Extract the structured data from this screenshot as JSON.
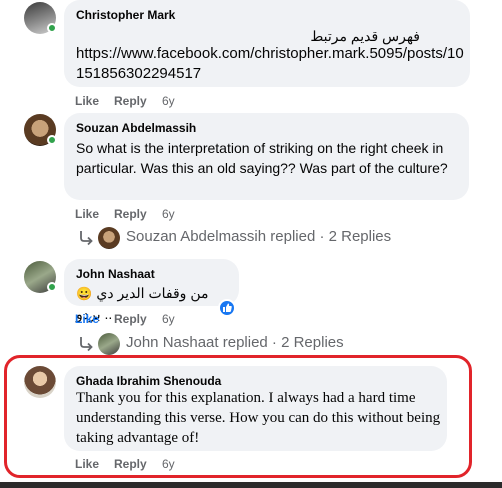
{
  "comments": [
    {
      "author": "Christopher Mark",
      "text_rtl": "فهرس قديم مرتبط",
      "text": "https://www.facebook.com/christopher.mark.5095/posts/10151856302294517",
      "actions": {
        "like": "Like",
        "reply": "Reply",
        "age": "6y"
      }
    },
    {
      "author": "Souzan Abdelmassih",
      "text": "So what is the interpretation of striking on the right cheek in particular. Was this an old saying?? Was part of the culture?",
      "actions": {
        "like": "Like",
        "reply": "Reply",
        "age": "6y"
      },
      "replies_summary": "Souzan Abdelmassih replied · 2 Replies"
    },
    {
      "author": "John Nashaat",
      "text_rtl": "من وقفات الدير دي بردو ..",
      "emoji": "😀",
      "actions": {
        "like": "Like",
        "reply": "Reply",
        "age": "6y"
      },
      "replies_summary": "John Nashaat replied · 2 Replies"
    },
    {
      "author": "Ghada Ibrahim Shenouda",
      "text": "Thank you for this explanation. I always had a hard time understanding this verse. How you can do this without being taking advantage of!",
      "actions": {
        "like": "Like",
        "reply": "Reply",
        "age": "6y"
      }
    }
  ],
  "colors": {
    "bubble": "#f0f2f5",
    "meta": "#65676b",
    "like_active": "#1877f2",
    "highlight": "#e1242a",
    "online": "#31a24c"
  },
  "icons": [
    "reply-arrow-icon",
    "like-reaction-icon",
    "online-status-icon"
  ]
}
